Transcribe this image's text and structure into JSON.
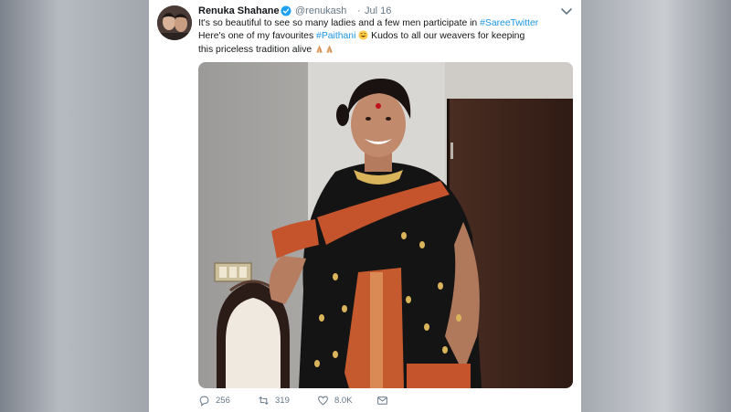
{
  "tweet": {
    "author_name": "Renuka Shahane",
    "handle": "@renukash",
    "separator": "·",
    "date": "Jul 16",
    "text": {
      "line1_pre": "It's so beautiful to see so many ladies and a few men participate in ",
      "hashtag1": "#SareeTwitter",
      "line2_pre": "Here's one of my favourites ",
      "hashtag2": "#Paithani",
      "line2_post": " Kudos to all our weavers for keeping",
      "line3": "this priceless tradition alive "
    },
    "icons": {
      "verified": "verified-badge-icon",
      "menu": "chevron-down-icon",
      "emoji_smile": "smiling-face-icon",
      "emoji_pray": "folded-hands-icon",
      "reply": "reply-icon",
      "retweet": "retweet-icon",
      "like": "heart-icon",
      "dm": "envelope-icon"
    },
    "stats": {
      "replies": "256",
      "retweets": "319",
      "likes": "8.0K"
    }
  },
  "colors": {
    "hashtag": "#1b95e0",
    "verified": "#1da1f2",
    "muted": "#657786",
    "saree_black": "#141414",
    "saree_border": "#c5542c"
  }
}
